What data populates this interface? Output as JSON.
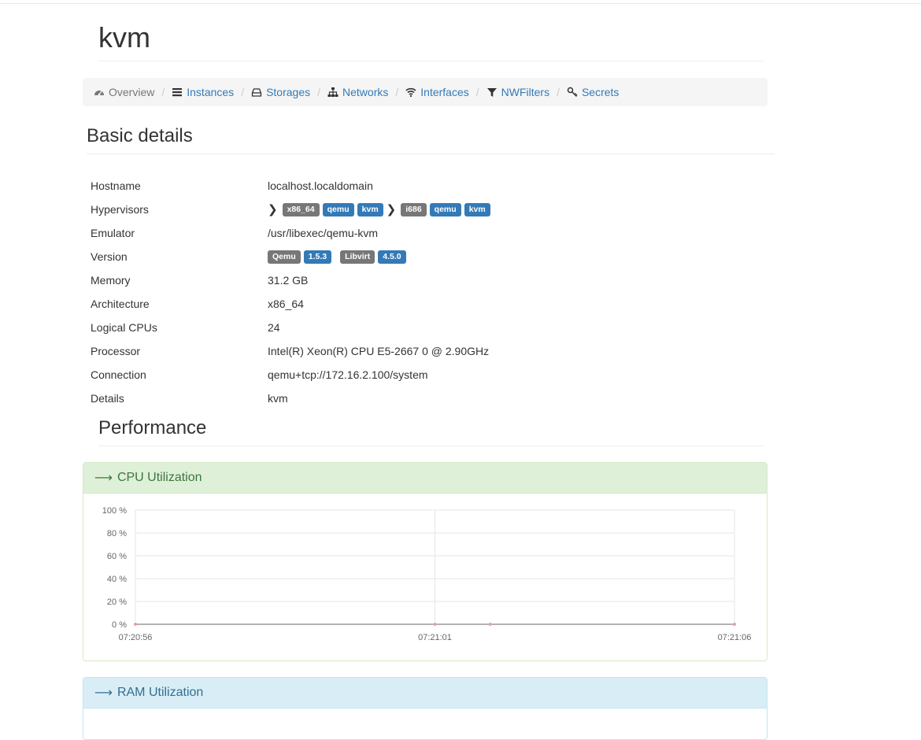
{
  "page": {
    "title": "kvm"
  },
  "breadcrumb": [
    {
      "label": "Overview",
      "icon": "dashboard-icon",
      "active": true
    },
    {
      "label": "Instances",
      "icon": "list-icon",
      "active": false
    },
    {
      "label": "Storages",
      "icon": "hdd-icon",
      "active": false
    },
    {
      "label": "Networks",
      "icon": "sitemap-icon",
      "active": false
    },
    {
      "label": "Interfaces",
      "icon": "wifi-icon",
      "active": false
    },
    {
      "label": "NWFilters",
      "icon": "filter-icon",
      "active": false
    },
    {
      "label": "Secrets",
      "icon": "key-icon",
      "active": false
    }
  ],
  "basic": {
    "heading": "Basic details",
    "hostname": {
      "key": "Hostname",
      "value": "localhost.localdomain"
    },
    "hypervisors": {
      "key": "Hypervisors",
      "groups": [
        {
          "arch": "x86_64",
          "tags": [
            "qemu",
            "kvm"
          ]
        },
        {
          "arch": "i686",
          "tags": [
            "qemu",
            "kvm"
          ]
        }
      ]
    },
    "emulator": {
      "key": "Emulator",
      "value": "/usr/libexec/qemu-kvm"
    },
    "version": {
      "key": "Version",
      "qemu_label": "Qemu",
      "qemu_version": "1.5.3",
      "libvirt_label": "Libvirt",
      "libvirt_version": "4.5.0"
    },
    "memory": {
      "key": "Memory",
      "value": "31.2 GB"
    },
    "architecture": {
      "key": "Architecture",
      "value": "x86_64"
    },
    "logical_cpus": {
      "key": "Logical CPUs",
      "value": "24"
    },
    "processor": {
      "key": "Processor",
      "value": "Intel(R) Xeon(R) CPU E5-2667 0 @ 2.90GHz"
    },
    "connection": {
      "key": "Connection",
      "value": "qemu+tcp://172.16.2.100/system"
    },
    "details": {
      "key": "Details",
      "value": "kvm"
    }
  },
  "performance": {
    "heading": "Performance",
    "cpu_panel": {
      "title": "CPU Utilization"
    },
    "ram_panel": {
      "title": "RAM Utilization"
    }
  },
  "colors": {
    "link": "#337ab7",
    "label_gray": "#777777",
    "label_blue": "#337ab7",
    "series": "#e8a0a0"
  },
  "chart_data": {
    "type": "line",
    "title": "",
    "xlabel": "",
    "ylabel": "",
    "x": [
      "07:20:56",
      "07:21:01",
      "07:21:06"
    ],
    "x_ticks": [
      "07:20:56",
      "07:21:01",
      "07:21:06"
    ],
    "y_ticks": [
      "100 %",
      "80 %",
      "60 %",
      "40 %",
      "20 %",
      "0 %"
    ],
    "ylim": [
      0,
      100
    ],
    "grid": true,
    "series": [
      {
        "values": [
          0,
          0,
          0
        ],
        "color": "#e8a0a0"
      }
    ]
  }
}
